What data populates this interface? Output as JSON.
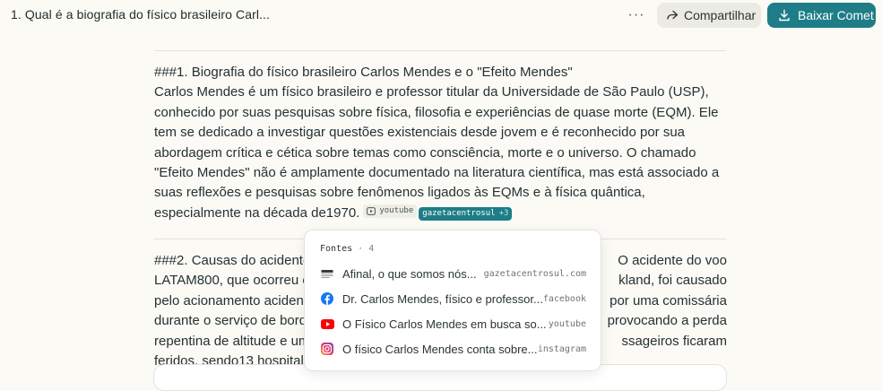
{
  "header": {
    "thread_title": "1. Qual é a biografia do físico brasileiro Carl...",
    "more_label": "···",
    "share_label": "Compartilhar",
    "download_label": "Baixar Comet",
    "accent": "#1e7d87"
  },
  "answer": {
    "section1_heading": "###1. Biografia do físico brasileiro Carlos Mendes e o \"Efeito Mendes\"",
    "section1_body": "Carlos Mendes é um físico brasileiro e professor titular da Universidade de São Paulo (USP), conhecido por suas pesquisas sobre física, filosofia e experiências de quase morte (EQM). Ele tem se dedicado a investigar questões existenciais desde jovem e é reconhecido por sua abordagem crítica e cética sobre temas como consciência, morte e o universo. O chamado \"Efeito Mendes\" não é amplamente documentado na literatura científica, mas está associado a suas reflexões e pesquisas sobre fenômenos ligados às EQMs e à física quântica, especialmente na década de1970.",
    "chip_youtube": "youtube",
    "chip_source": "gazetacentrosul",
    "chip_source_more": "+3",
    "section2_lines": [
      {
        "left": "###2. Causas do acidente",
        "right": "O acidente do voo"
      },
      {
        "left": "LATAM800, que ocorreu e",
        "right": "kland, foi causado"
      },
      {
        "left": "pelo acionamento acident",
        "right": "por uma comissária"
      },
      {
        "left": "durante o serviço de bord",
        "right": "provocando a perda"
      },
      {
        "left": "repentina de altitude e um",
        "right": "ssageiros ficaram"
      },
      {
        "left": "feridos, sendo13 hospitaliz",
        "right": ""
      }
    ]
  },
  "sources_popover": {
    "label": "Fontes",
    "separator": "·",
    "count": "4",
    "items": [
      {
        "title": "Afinal, o que somos nós...",
        "domain": "gazetacentrosul.com",
        "icon": "news-icon"
      },
      {
        "title": "Dr. Carlos Mendes, físico e professor...",
        "domain": "facebook",
        "icon": "facebook-icon"
      },
      {
        "title": "O Físico Carlos Mendes em busca so...",
        "domain": "youtube",
        "icon": "youtube-icon"
      },
      {
        "title": "O físico Carlos Mendes conta sobre...",
        "domain": "instagram",
        "icon": "instagram-icon"
      }
    ]
  }
}
